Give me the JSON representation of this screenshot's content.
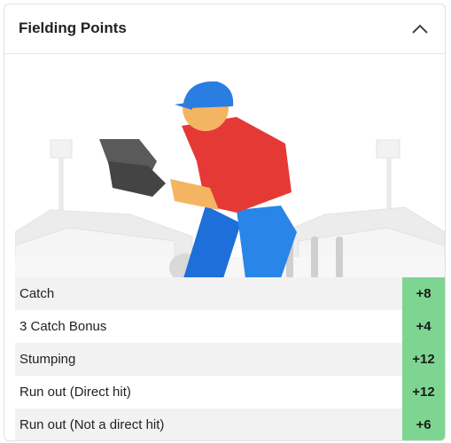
{
  "section": {
    "title": "Fielding Points",
    "collapse_icon": "chevron-up-icon"
  },
  "illustration": {
    "icon": "wicketkeeper-illustration",
    "colors": {
      "cap": "#2a7de1",
      "shirt": "#e53935",
      "pants": "#1e6fd9",
      "gloves": "#555555",
      "stadium": "#e9e9e9"
    }
  },
  "points_table": {
    "rows": [
      {
        "label": "Catch",
        "points": "+8"
      },
      {
        "label": "3 Catch Bonus",
        "points": "+4"
      },
      {
        "label": "Stumping",
        "points": "+12"
      },
      {
        "label": "Run out (Direct hit)",
        "points": "+12"
      },
      {
        "label": "Run out (Not a direct hit)",
        "points": "+6"
      }
    ],
    "badge_color": "#7ed591"
  }
}
